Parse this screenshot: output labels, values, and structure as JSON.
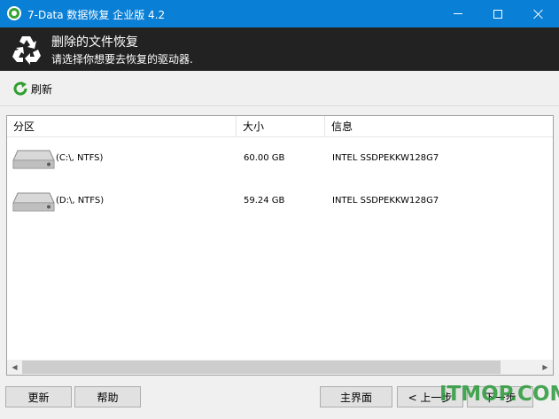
{
  "window": {
    "title": "7-Data 数据恢复 企业版 4.2",
    "accent": "#0a7fd6"
  },
  "header": {
    "title": "删除的文件恢复",
    "subtitle": "请选择你想要去恢复的驱动器.",
    "icon": "recycle-icon"
  },
  "toolbar": {
    "refresh_label": "刷新",
    "refresh_icon": "refresh-icon"
  },
  "list": {
    "columns": [
      "分区",
      "大小",
      "信息"
    ],
    "rows": [
      {
        "name": "(C:\\, NTFS)",
        "size": "60.00 GB",
        "info": "INTEL SSDPEKKW128G7",
        "icon": "drive-icon"
      },
      {
        "name": "(D:\\, NTFS)",
        "size": "59.24 GB",
        "info": "INTEL SSDPEKKW128G7",
        "icon": "drive-icon"
      }
    ]
  },
  "footer": {
    "update_label": "更新",
    "help_label": "帮助",
    "main_label": "主界面",
    "prev_label": "< 上一步",
    "next_label": "下一步"
  },
  "watermark": "ITMOP.COM"
}
